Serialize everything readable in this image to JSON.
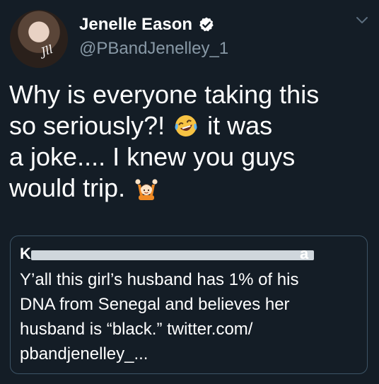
{
  "user": {
    "name": "Jenelle Eason",
    "handle": "@PBandJenelley_1",
    "verified": true
  },
  "tweet": {
    "line1": "Why is everyone taking this",
    "line2a": "so seriously?!",
    "line2b": "it was",
    "line3": "a joke.... I knew you guys",
    "line4": "would trip.",
    "emoji1": "face-with-tears-of-joy-icon",
    "emoji2": "person-raising-both-hands-icon"
  },
  "quoted_tweet": {
    "author_visible_start": "K",
    "author_visible_end": "a",
    "text_line1": "Y’all this girl’s husband has 1% of his",
    "text_line2": "DNA from Senegal and believes her",
    "text_line3": "husband is “black.” twitter.com/",
    "text_line4": "pbandjenelley_..."
  },
  "colors": {
    "background": "#141d26",
    "secondary_text": "#8899a6",
    "border": "#3d5466"
  }
}
